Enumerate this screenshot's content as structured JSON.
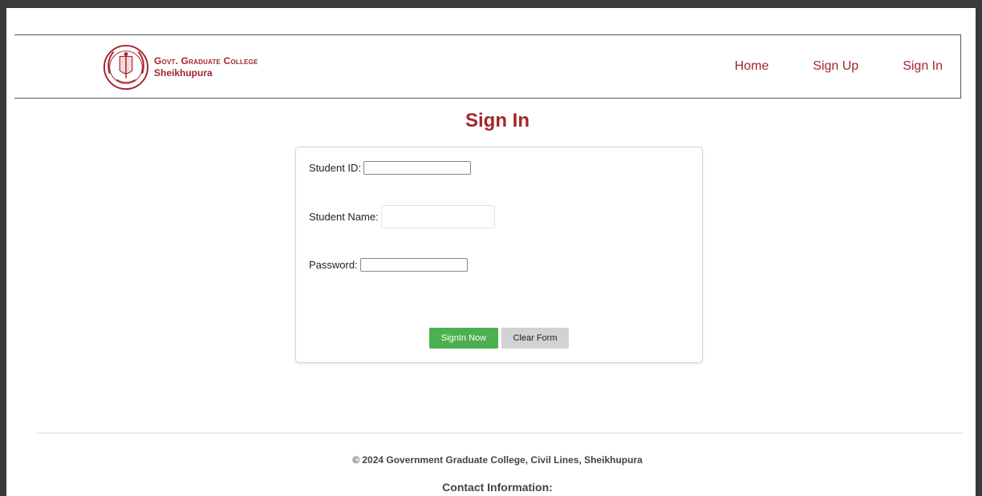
{
  "header": {
    "college_line1": "Govt. Graduate College",
    "college_line2": "Sheikhupura",
    "nav": [
      "Home",
      "Sign Up",
      "Sign In"
    ]
  },
  "page": {
    "title": "Sign In"
  },
  "form": {
    "student_id_label": "Student ID:",
    "student_id_value": "",
    "student_name_label": "Student Name:",
    "student_name_value": "",
    "password_label": "Password:",
    "password_value": "",
    "submit_label": "SignIn Now",
    "clear_label": "Clear Form"
  },
  "footer": {
    "copyright": "© 2024 Government Graduate College, Civil Lines, Sheikhupura",
    "contact_heading": "Contact Information:"
  },
  "colors": {
    "brand": "#a3262a",
    "primary_button": "#4caf50",
    "secondary_button": "#d2d2d2"
  },
  "icons": {
    "logo": "college-seal-icon"
  }
}
